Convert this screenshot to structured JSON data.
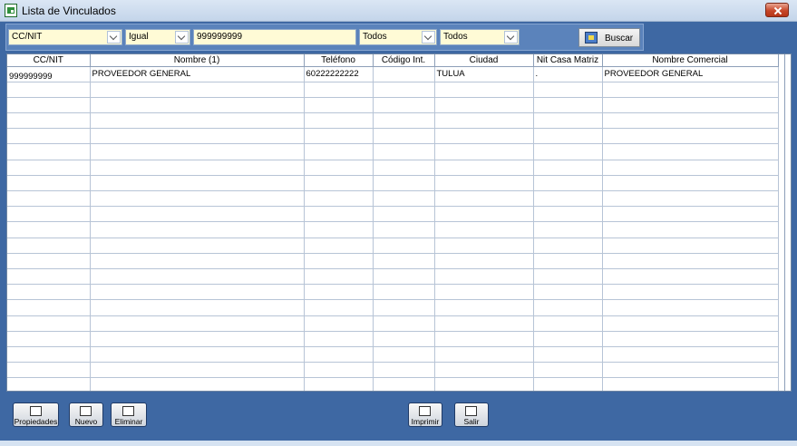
{
  "window": {
    "title": "Lista de Vinculados"
  },
  "filters": {
    "field": "CC/NIT",
    "operator": "Igual",
    "search_value": "999999999",
    "filter1": "Todos",
    "filter2": "Todos",
    "search_button": "Buscar"
  },
  "table": {
    "columns": [
      "CC/NIT",
      "Nombre (1)",
      "Teléfono",
      "Código Int.",
      "Ciudad",
      "Nit Casa Matriz",
      "Nombre Comercial"
    ],
    "rows": [
      [
        "999999999",
        "PROVEEDOR GENERAL",
        "60222222222",
        "",
        "TULUA",
        ".",
        "PROVEEDOR GENERAL"
      ]
    ]
  },
  "buttons": {
    "propiedades": "Propiedades",
    "nuevo": "Nuevo",
    "eliminar": "Eliminar",
    "imprimir": "Imprimir",
    "salir": "Salir"
  }
}
